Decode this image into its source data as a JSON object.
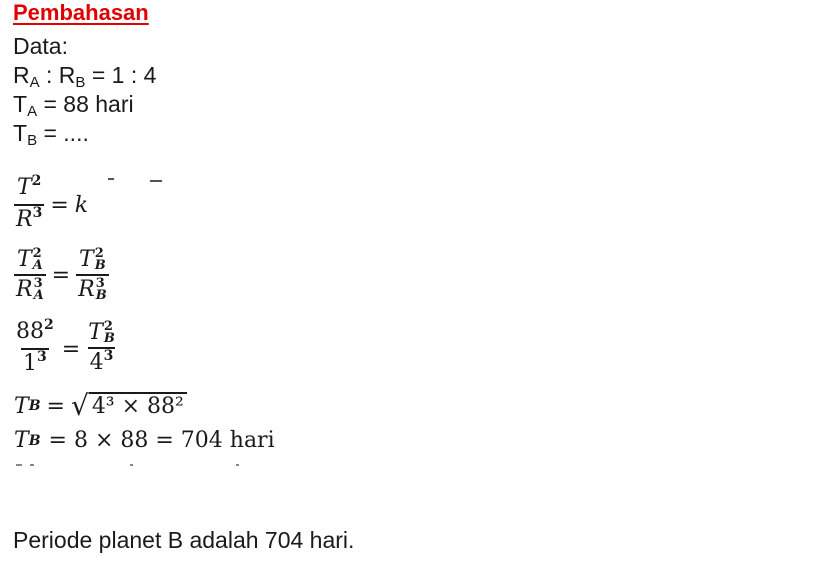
{
  "heading": "Pembahasan",
  "data_label": "Data:",
  "ratio": {
    "r": "R",
    "a": "A",
    "sep": " : R",
    "b": "B",
    "value": " = 1 : 4"
  },
  "ta": {
    "t": "T",
    "sub": "A",
    "value": " = 88 hari"
  },
  "tb": {
    "t": "T",
    "sub": "B",
    "value": " = ...."
  },
  "eq1": {
    "num": "T",
    "num_exp": "2",
    "den": "R",
    "den_exp": "3",
    "op": "=",
    "rhs": "k"
  },
  "eq2": {
    "ln": "T",
    "ln_exp": "2",
    "ln_sub": "A",
    "ld": "R",
    "ld_exp": "3",
    "ld_sub": "A",
    "op": "=",
    "rn": "T",
    "rn_exp": "2",
    "rn_sub": "B",
    "rd": "R",
    "rd_exp": "3",
    "rd_sub": "B"
  },
  "eq3": {
    "ln": "88",
    "ln_exp": "2",
    "ld": "1",
    "ld_exp": "3",
    "op": "=",
    "rn": "T",
    "rn_exp": "2",
    "rn_sub": "B",
    "rd": "4",
    "rd_exp": "3"
  },
  "eq4": {
    "lhs": "T",
    "lhs_sub": "B",
    "op": "=",
    "rad": "4³ × 88²"
  },
  "eq5": {
    "lhs": "T",
    "lhs_sub": "B",
    "rhs": "= 8 × 88 = 704 hari"
  },
  "conclusion": "Periode planet B adalah 704 hari."
}
